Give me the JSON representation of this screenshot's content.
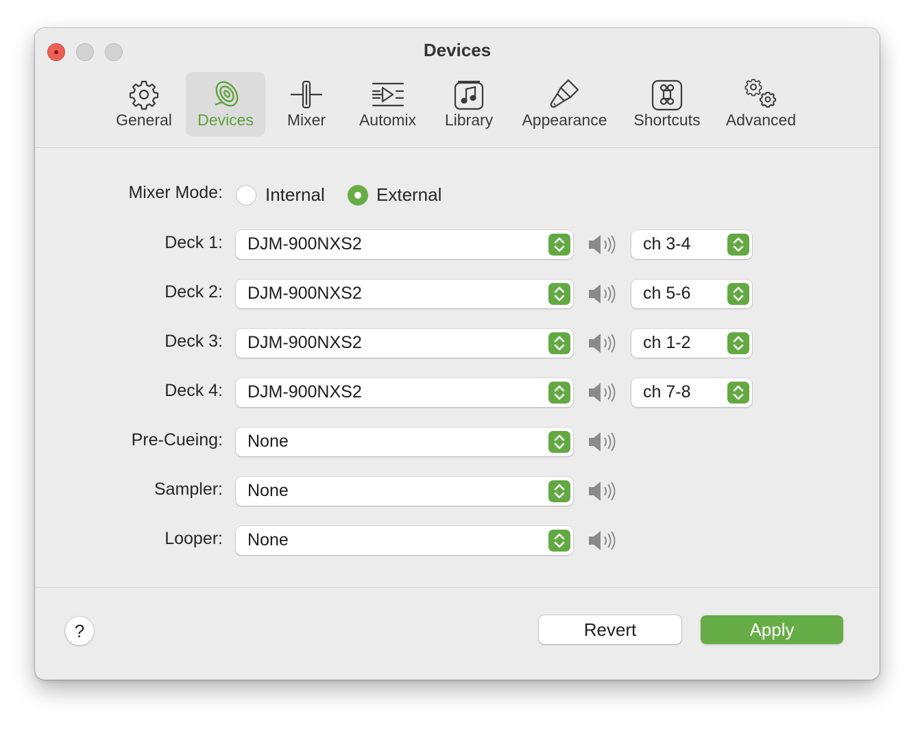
{
  "window": {
    "title": "Devices"
  },
  "toolbar": {
    "tabs": [
      {
        "label": "General",
        "icon": "gear-icon"
      },
      {
        "label": "Devices",
        "icon": "speaker-icon",
        "selected": true
      },
      {
        "label": "Mixer",
        "icon": "fader-icon"
      },
      {
        "label": "Automix",
        "icon": "automix-icon"
      },
      {
        "label": "Library",
        "icon": "music-note-icon"
      },
      {
        "label": "Appearance",
        "icon": "paintbrush-icon"
      },
      {
        "label": "Shortcuts",
        "icon": "command-key-icon"
      },
      {
        "label": "Advanced",
        "icon": "gears-icon"
      }
    ]
  },
  "mixer_mode": {
    "label": "Mixer Mode:",
    "options": [
      {
        "label": "Internal",
        "selected": false
      },
      {
        "label": "External",
        "selected": true
      }
    ]
  },
  "rows": [
    {
      "label": "Deck 1:",
      "device": "DJM-900NXS2",
      "channel": "ch 3-4"
    },
    {
      "label": "Deck 2:",
      "device": "DJM-900NXS2",
      "channel": "ch 5-6"
    },
    {
      "label": "Deck 3:",
      "device": "DJM-900NXS2",
      "channel": "ch 1-2"
    },
    {
      "label": "Deck 4:",
      "device": "DJM-900NXS2",
      "channel": "ch 7-8"
    },
    {
      "label": "Pre-Cueing:",
      "device": "None"
    },
    {
      "label": "Sampler:",
      "device": "None"
    },
    {
      "label": "Looper:",
      "device": "None"
    }
  ],
  "footer": {
    "help_label": "?",
    "revert_label": "Revert",
    "apply_label": "Apply"
  },
  "colors": {
    "accent": "#67ad47",
    "close_button": "#ed5f57",
    "window_bg": "#ececec"
  }
}
